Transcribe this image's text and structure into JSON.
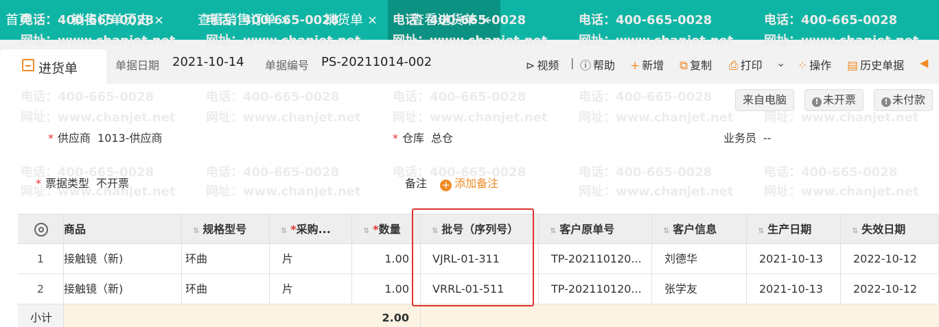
{
  "tabs": [
    {
      "label": "首页",
      "closable": false,
      "active": false
    },
    {
      "label": "销售订单历史",
      "closable": true,
      "active": false
    },
    {
      "label": "查看销售订单",
      "closable": true,
      "active": false
    },
    {
      "label": "销货单",
      "closable": true,
      "active": false
    },
    {
      "label": "查看进货单",
      "closable": true,
      "active": true
    }
  ],
  "close_glyph": "×",
  "watermark": {
    "phone": "电话：400-665-0028",
    "site": "网址：www.chanjet.net"
  },
  "header": {
    "doc_type": "进货单",
    "date_label": "单据日期",
    "date_value": "2021-10-14",
    "number_label": "单据编号",
    "number_value": "PS-20211014-002"
  },
  "toolbar": {
    "video": "视频",
    "help": "帮助",
    "add": "新增",
    "copy": "复制",
    "print": "打印",
    "operate": "操作",
    "history": "历史单据"
  },
  "status_pills": {
    "source": "来自电脑",
    "invoice": "未开票",
    "payment": "未付款"
  },
  "form": {
    "supplier_label": "供应商",
    "supplier_value": "1013-供应商",
    "warehouse_label": "仓库",
    "warehouse_value": "总仓",
    "salesman_label": "业务员",
    "salesman_value": "--",
    "invoice_type_label": "票据类型",
    "invoice_type_value": "不开票",
    "remark_label": "备注",
    "add_remark": "添加备注"
  },
  "table": {
    "columns": [
      "商品",
      "规格型号",
      "采购...",
      "数量",
      "批号（序列号）",
      "客户原单号",
      "客户信息",
      "生产日期",
      "失效日期"
    ],
    "rows": [
      {
        "no": "1",
        "product": "接触镜（新)",
        "spec": "环曲",
        "unit": "片",
        "qty": "1.00",
        "batch": "VJRL-01-311",
        "order_no": "TP-202110120...",
        "customer": "刘德华",
        "prod_date": "2021-10-13",
        "exp_date": "2022-10-12"
      },
      {
        "no": "2",
        "product": "接触镜（新)",
        "spec": "环曲",
        "unit": "片",
        "qty": "1.00",
        "batch": "VRRL-01-511",
        "order_no": "TP-202110120...",
        "customer": "张学友",
        "prod_date": "2021-10-13",
        "exp_date": "2022-10-12"
      }
    ],
    "subtotal_label": "小计",
    "subtotal_qty": "2.00"
  },
  "colors": {
    "tabbar": "#0fb5a4",
    "tab_active": "#0c9282",
    "accent": "#f08a24",
    "required": "#e0312c",
    "highlight": "#e0312c",
    "subtotal_bg": "#fdf3e3"
  }
}
